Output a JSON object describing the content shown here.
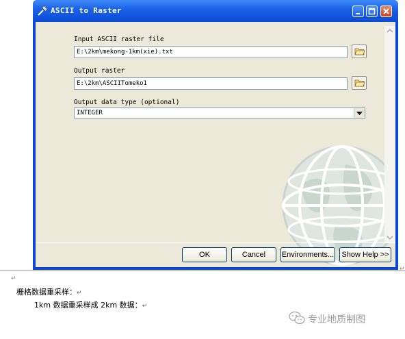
{
  "window": {
    "title": "ASCII to Raster"
  },
  "form": {
    "input_label": "Input ASCII raster file",
    "input_value": "E:\\2km\\mekong-1km(xie).txt",
    "output_label": "Output raster",
    "output_value": "E:\\2km\\ASCIITomeko1",
    "type_label": "Output data type (optional)",
    "type_value": "INTEGER"
  },
  "buttons": {
    "ok": "OK",
    "cancel": "Cancel",
    "environments": "Environments...",
    "show_help": "Show Help >>"
  },
  "doc": {
    "line1": "栅格数据重采样：",
    "line2": "1km 数据重采样成 2km 数据：",
    "para_mark": "↵",
    "small_mark": "↵"
  },
  "watermark": {
    "text": "专业地质制图"
  },
  "icons": {
    "title": "hammer-tool-icon",
    "browse": "open-folder-icon",
    "dropdown": "chevron-down-icon",
    "globe": "globe-watermark-icon",
    "wechat": "wechat-icon"
  },
  "colors": {
    "titlebar": "#0a4bd6",
    "client": "#ece9d8",
    "close_button": "#c9401c"
  }
}
